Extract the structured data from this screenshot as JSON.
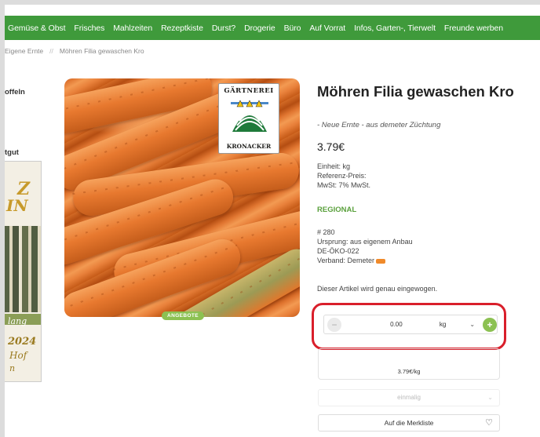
{
  "nav": {
    "items": [
      "Gemüse & Obst",
      "Frisches",
      "Mahlzeiten",
      "Rezeptkiste",
      "Durst?",
      "Drogerie",
      "Büro",
      "Auf Vorrat",
      "Infos, Garten-, Tierwelt",
      "Freunde werben"
    ]
  },
  "breadcrumb": {
    "items": [
      "Eigene Ernte",
      "Möhren Filia gewaschen Kro"
    ],
    "separator": "//"
  },
  "sidebar": {
    "fragment1": "offeln",
    "fragment2": "tgut",
    "banner_text1": "Z",
    "banner_text2": "IN",
    "banner_text3": "lang",
    "banner_year": "2024",
    "banner_line2": "Hof",
    "banner_line3": "n"
  },
  "product": {
    "title": "Möhren Filia gewaschen Kro",
    "subtitle": "- Neue Ernte - aus demeter Züchtung",
    "price": "3.79€",
    "unit": "Einheit: kg",
    "reference_price": "Referenz-Preis:",
    "vat": "MwSt: 7% MwSt.",
    "regional": "REGIONAL",
    "number": "# 280",
    "origin": "Ursprung: aus eigenem Anbau",
    "eco_code": "DE-ÖKO-022",
    "association": "Verband: Demeter",
    "weigh_note": "Dieser Artikel wird genau eingewogen.",
    "offer_badge": "ANGEBOTE",
    "logo_top": "GÄRTNEREI",
    "logo_bottom": "KRONACKER"
  },
  "quantity": {
    "minus": "−",
    "value": "0.00",
    "unit": "kg",
    "plus": "+"
  },
  "total": {
    "unit_price": "3.79€/kg"
  },
  "frequency": {
    "selected": "einmalig"
  },
  "wishlist": {
    "label": "Auf die Merkliste"
  },
  "colors": {
    "nav_green": "#3f9a3b",
    "accent_green": "#8cc152",
    "highlight_red": "#d91f2b"
  }
}
